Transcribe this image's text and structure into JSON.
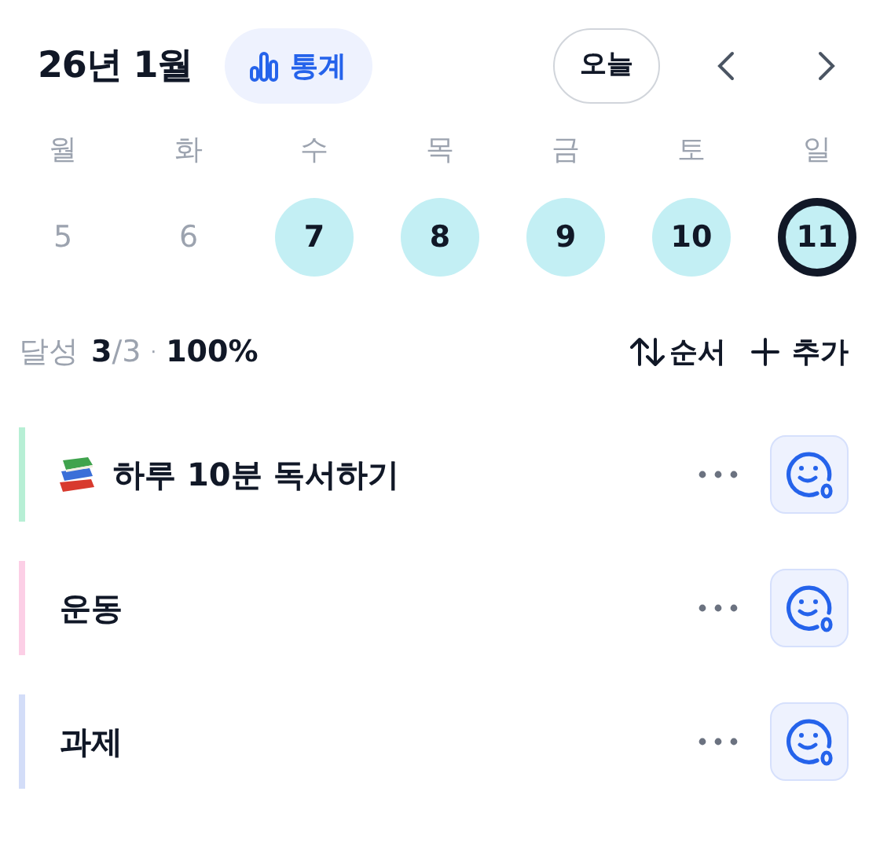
{
  "header": {
    "title": "26년 1월",
    "stats_button": "통계",
    "today_button": "오늘"
  },
  "week": [
    {
      "weekday": "월",
      "day": "5",
      "done": false,
      "today": false
    },
    {
      "weekday": "화",
      "day": "6",
      "done": false,
      "today": false
    },
    {
      "weekday": "수",
      "day": "7",
      "done": true,
      "today": false
    },
    {
      "weekday": "목",
      "day": "8",
      "done": true,
      "today": false
    },
    {
      "weekday": "금",
      "day": "9",
      "done": true,
      "today": false
    },
    {
      "weekday": "토",
      "day": "10",
      "done": true,
      "today": false
    },
    {
      "weekday": "일",
      "day": "11",
      "done": true,
      "today": true
    }
  ],
  "summary": {
    "label": "달성",
    "done": "3",
    "total": "/3",
    "separator": "·",
    "percent": "100%",
    "sort_button": "순서",
    "add_button": "추가"
  },
  "habits": [
    {
      "name": "하루 10분 독서하기",
      "book_emoji": true,
      "color": "#b7efd5"
    },
    {
      "name": "운동",
      "book_emoji": false,
      "color": "#fccfe6"
    },
    {
      "name": "과제",
      "book_emoji": false,
      "color": "#d3ddf8"
    }
  ]
}
